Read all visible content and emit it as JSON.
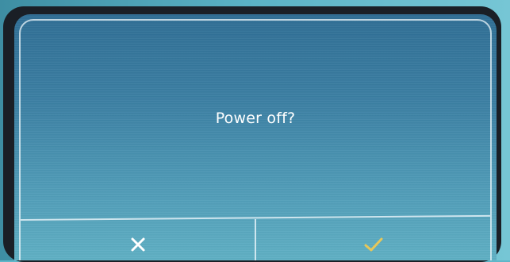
{
  "dialog": {
    "message": "Power off?"
  },
  "buttons": {
    "cancel_icon": "close-icon",
    "confirm_icon": "check-icon"
  },
  "colors": {
    "screen_top": "#2f6e95",
    "screen_bottom": "#5fb0c4",
    "text": "#ffffff",
    "confirm_accent": "#e6c75a",
    "bezel": "#1a1f26"
  }
}
